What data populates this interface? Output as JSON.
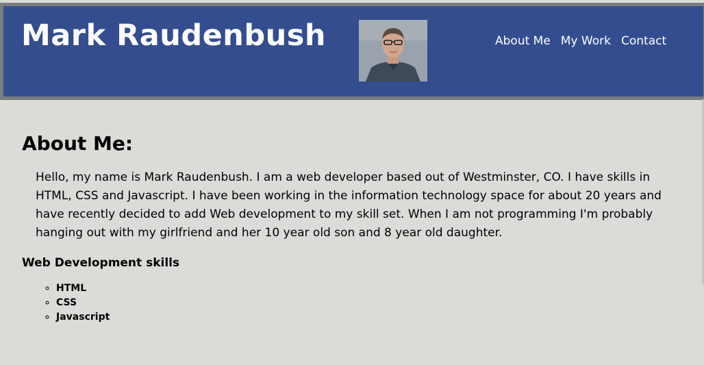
{
  "header": {
    "title": "Mark Raudenbush",
    "nav": [
      {
        "label": "About Me"
      },
      {
        "label": "My Work"
      },
      {
        "label": "Contact"
      }
    ]
  },
  "about": {
    "heading": "About Me:",
    "intro": "Hello, my name is Mark Raudenbush. I am a web developer based out of Westminster, CO. I have skills in HTML, CSS and Javascript. I have been working in the information technology space for about 20 years and have recently decided to add Web development to my skill set. When I am not programming I'm probably hanging out with my girlfriend and her 10 year old son and 8 year old daughter.",
    "skills_heading": "Web Development skills",
    "skills": [
      "HTML",
      "CSS",
      "Javascript"
    ]
  },
  "colors": {
    "header_bg": "#344d8f",
    "header_border": "#7a7d7e",
    "page_bg": "#d9dcd7"
  }
}
